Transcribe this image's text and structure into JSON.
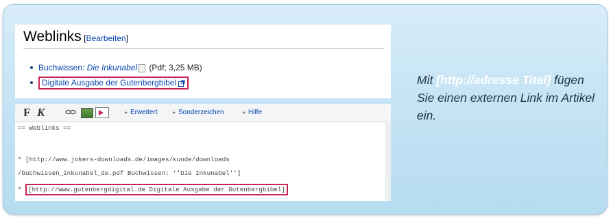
{
  "wiki": {
    "heading": "Weblinks",
    "edit_bracket_open": " [",
    "edit_link": "Bearbeiten",
    "edit_bracket_close": "]",
    "item1_link": "Buchwissen: ",
    "item1_italic": "Die Inkunabel",
    "item1_suffix": " (Pdf; 3,25 MB)",
    "item2_link": "Digitale Ausgabe der Gutenbergbibel"
  },
  "editor": {
    "toolbar": {
      "bold": "F",
      "italic": "K",
      "menu_advanced": "Erweitert",
      "menu_special": "Sonderzeichen",
      "menu_help": "Hilfe"
    },
    "lines": {
      "l1": "== Weblinks ==",
      "l2": "* [http://www.jokers-downloads.de/images/kunde/downloads",
      "l3": "/buchwissen_inkunabel_de.pdf Buchwissen: ''Die Inkunabel'']",
      "l4_prefix": "* ",
      "l4_highlight": "[http://www.gutenbergdigital.de Digitale Ausgabe der Gutenbergbibel]"
    }
  },
  "caption": {
    "pre": "Mit ",
    "highlight": "[http://adresse Titel]",
    "post": " fügen Sie einen externen Link im Artikel ein."
  },
  "colors": {
    "panel": "#c4e3f4",
    "link": "#0645ad",
    "highlight_border": "#c8234e",
    "caption_highlight": "#ffffff"
  }
}
